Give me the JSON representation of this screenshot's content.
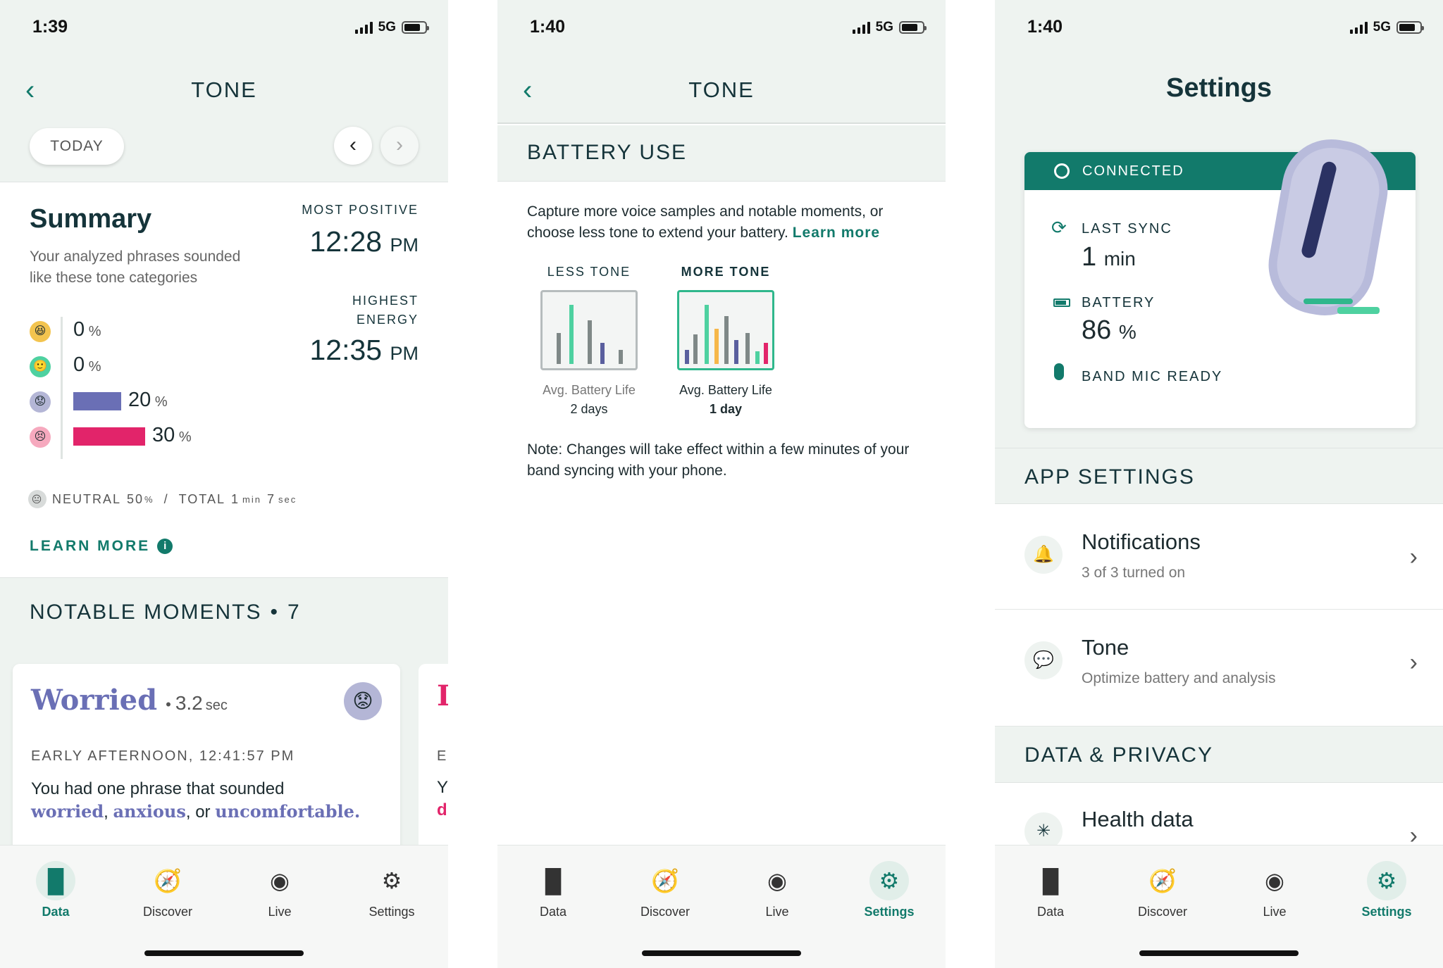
{
  "status": {
    "time1": "1:39",
    "time2": "1:40",
    "time3": "1:40",
    "network": "5G"
  },
  "tone_screen": {
    "title": "TONE",
    "today_label": "TODAY",
    "summary": {
      "heading": "Summary",
      "description": "Your analyzed phrases sounded like these tone categories",
      "most_positive_label": "MOST POSITIVE",
      "most_positive_time": "12:28",
      "most_positive_ampm": "PM",
      "highest_energy_label_1": "HIGHEST",
      "highest_energy_label_2": "ENERGY",
      "highest_energy_time": "12:35",
      "highest_energy_ampm": "PM",
      "categories": [
        {
          "value": "0",
          "unit": "%",
          "percent": 0,
          "color": "#f3c44f"
        },
        {
          "value": "0",
          "unit": "%",
          "percent": 0,
          "color": "#4ed1a0"
        },
        {
          "value": "20",
          "unit": "%",
          "percent": 20,
          "color": "#6a6fb5"
        },
        {
          "value": "30",
          "unit": "%",
          "percent": 30,
          "color": "#e2246a"
        }
      ],
      "neutral_label": "NEUTRAL",
      "neutral_value": "50",
      "neutral_unit": "%",
      "total_label": "TOTAL",
      "total_min": "1",
      "total_min_unit": "min",
      "total_sec": "7",
      "total_sec_unit": "sec",
      "learn_more": "LEARN MORE"
    },
    "notable": {
      "heading": "NOTABLE MOMENTS",
      "count": "7",
      "card": {
        "tone": "Worried",
        "duration": "3.2",
        "duration_unit": "sec",
        "time": "EARLY AFTERNOON, 12:41:57 PM",
        "text": "You had one phrase that sounded",
        "word1": "worried",
        "word2": "anxious",
        "sep1": ",",
        "sep2": ", or",
        "word3": "uncomfortable."
      },
      "next_card_initial": "I",
      "next_card_line1": "E",
      "next_card_line2": "Y",
      "next_card_line3": "d"
    }
  },
  "battery_screen": {
    "title": "TONE",
    "section": "BATTERY USE",
    "description": "Capture more voice samples and notable moments, or choose less tone to extend your battery.",
    "learn_more": "Learn more",
    "less_label": "LESS TONE",
    "more_label": "MORE TONE",
    "less_caption": "Avg. Battery Life",
    "less_days": "2 days",
    "more_caption": "Avg. Battery Life",
    "more_days": "1 day",
    "note": "Note: Changes will take effect within a few minutes of your band syncing with your phone."
  },
  "settings_screen": {
    "title": "Settings",
    "connected": "CONNECTED",
    "last_sync_label": "LAST SYNC",
    "last_sync_value": "1",
    "last_sync_unit": "min",
    "battery_label": "BATTERY",
    "battery_value": "86",
    "battery_unit": "%",
    "battery_level": 86,
    "mic_label": "BAND MIC READY",
    "app_settings": "APP SETTINGS",
    "notifications_title": "Notifications",
    "notifications_sub": "3 of 3 turned on",
    "tone_title": "Tone",
    "tone_sub": "Optimize battery and analysis",
    "data_privacy": "DATA & PRIVACY",
    "health_title": "Health data"
  },
  "tabs": {
    "data": "Data",
    "discover": "Discover",
    "live": "Live",
    "settings": "Settings"
  },
  "colors": {
    "accent": "#127a6b",
    "header_bg": "#eef3f0",
    "worried": "#6a6fb5",
    "negative": "#e2246a"
  }
}
